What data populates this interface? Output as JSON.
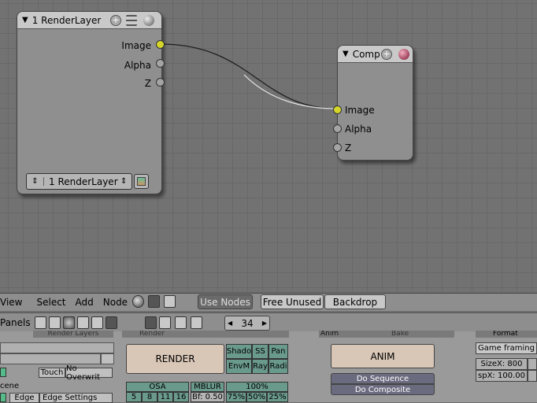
{
  "render_layer_node": {
    "title": "1 RenderLayer",
    "outputs": [
      "Image",
      "Alpha",
      "Z"
    ],
    "layer_select": "1 RenderLayer"
  },
  "composite_node": {
    "title": "Comp",
    "inputs": [
      "Image",
      "Alpha",
      "Z"
    ]
  },
  "node_menu": {
    "items": [
      "View",
      "Select",
      "Add",
      "Node"
    ],
    "use_nodes": "Use Nodes",
    "free_unused": "Free Unused",
    "backdrop": "Backdrop"
  },
  "buttons_header": {
    "panels_label": "Panels",
    "frame": "34"
  },
  "render_panel": {
    "tab_render_layers": "Render Layers",
    "tab_render": "Render",
    "touch": "Touch",
    "no_overwrite": "No Overwrit",
    "scene": "cene",
    "edge": "Edge",
    "edge_settings": "Edge Settings",
    "render_button": "RENDER",
    "shadow": "Shado",
    "ss": "SS",
    "pano": "Pan",
    "envmap": "EnvM",
    "ray": "Ray",
    "radio": "Radi",
    "osa": "OSA",
    "mblur": "MBLUR",
    "osa_values": [
      "5",
      "8",
      "11",
      "16"
    ],
    "bf": "Bf: 0.50",
    "percent": "100%",
    "percents": [
      "75%",
      "50%",
      "25%"
    ]
  },
  "anim_panel": {
    "title": "Anim",
    "bake": "Bake",
    "anim_button": "ANIM",
    "do_sequence": "Do Sequence",
    "do_composite": "Do Composite"
  },
  "format_panel": {
    "title": "Format",
    "game_framing": "Game framing se",
    "size_x": "SizeX: 800",
    "sp_x": "spX: 100.00"
  }
}
